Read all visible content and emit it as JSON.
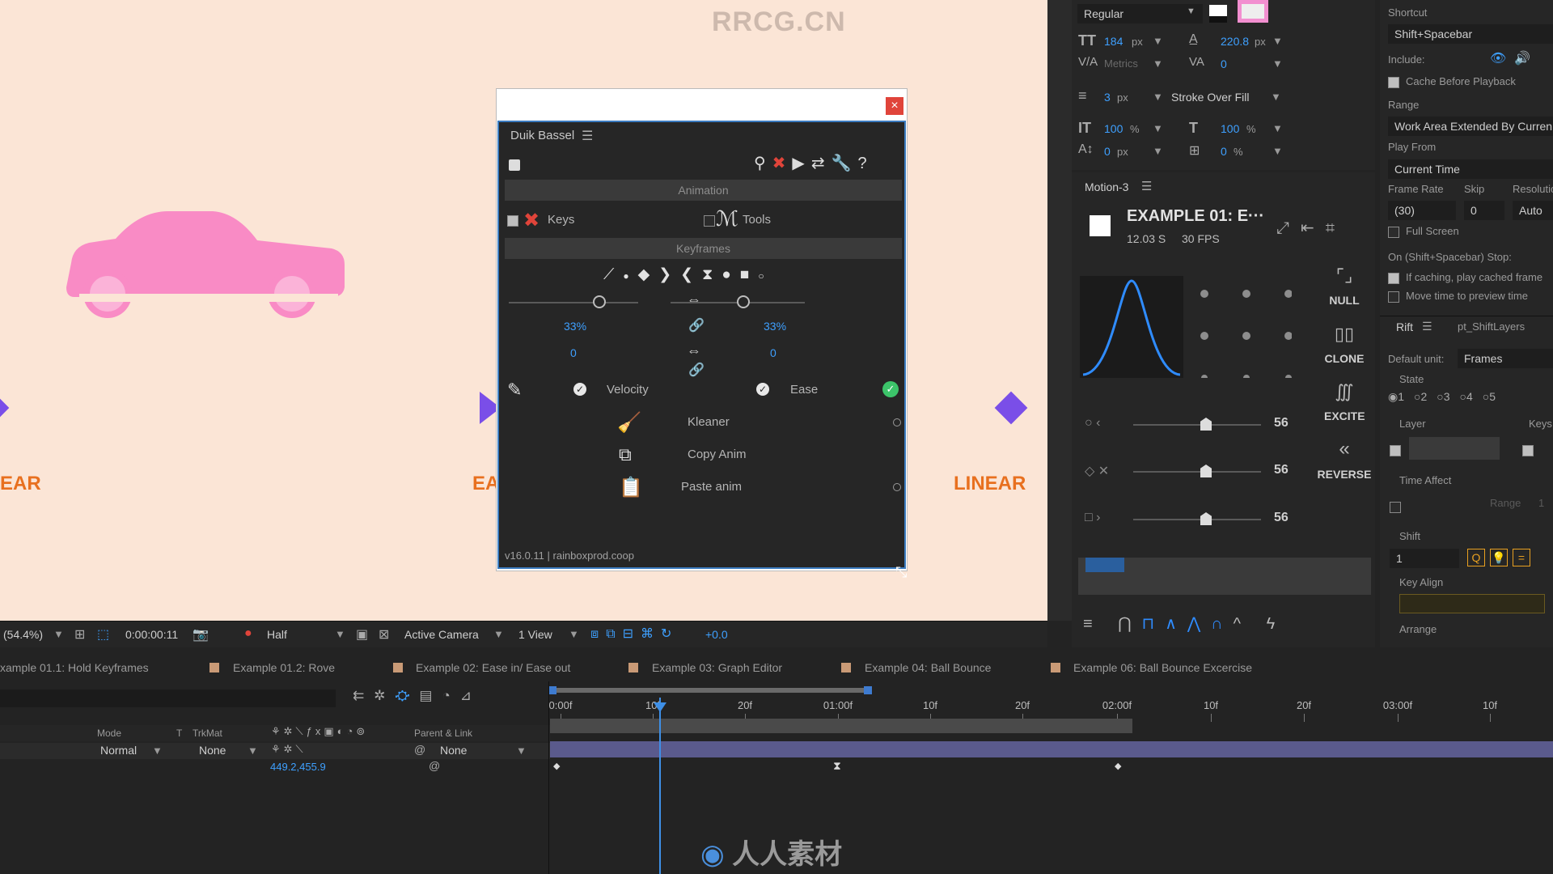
{
  "watermark": "RRCG.CN",
  "bottom_logo": "人人素材",
  "composition": {
    "label_left": "EAR",
    "label_mid": "EA",
    "label_right": "LINEAR",
    "car_color": "#f98bc5",
    "diamond_color": "#7a4ee8"
  },
  "duik": {
    "title": "Duik Bassel",
    "section_animation": "Animation",
    "keys_label": "Keys",
    "tools_label": "Tools",
    "section_keyframes": "Keyframes",
    "influence_left": "33%",
    "influence_right": "33%",
    "speed_left": "0",
    "speed_right": "0",
    "velocity_label": "Velocity",
    "ease_label": "Ease",
    "kleaner_label": "Kleaner",
    "copy_anim_label": "Copy Anim",
    "paste_anim_label": "Paste anim",
    "version": "v16.0.11 | rainboxprod.coop",
    "close_glyph": "×"
  },
  "character": {
    "font_style": "Regular",
    "font_size": "184",
    "font_size_unit": "px",
    "leading": "220.8",
    "leading_unit": "px",
    "kerning": "Metrics",
    "tracking": "0",
    "stroke_width": "3",
    "stroke_unit": "px",
    "stroke_mode": "Stroke Over Fill",
    "vscale": "100",
    "hscale": "100",
    "pct": "%",
    "baseline": "0",
    "baseline_unit": "px",
    "tsume": "0",
    "tsume_unit": "%"
  },
  "motion": {
    "title": "Motion-3",
    "comp_name": "EXAMPLE 01: E···",
    "duration": "12.03 S",
    "fps": "30 FPS",
    "null_label": "NULL",
    "clone_label": "CLONE",
    "excite_label": "EXCITE",
    "reverse_label": "REVERSE",
    "slider1": "56",
    "slider2": "56",
    "slider3": "56"
  },
  "preview": {
    "shortcut_label": "Shortcut",
    "shortcut_value": "Shift+Spacebar",
    "include_label": "Include:",
    "cache_label": "Cache Before Playback",
    "range_label": "Range",
    "range_value": "Work Area Extended By Curren",
    "play_from_label": "Play From",
    "play_from_value": "Current Time",
    "frame_rate_label": "Frame Rate",
    "skip_label": "Skip",
    "resolution_label": "Resolutio",
    "frame_rate_value": "(30)",
    "skip_value": "0",
    "resolution_value": "Auto",
    "full_screen": "Full Screen",
    "stop_label": "On (Shift+Spacebar) Stop:",
    "if_caching": "If caching, play cached frame",
    "move_time": "Move time to preview time",
    "rift_tab": "Rift",
    "shift_layers_tab": "pt_ShiftLayers",
    "default_unit_label": "Default unit:",
    "default_unit_value": "Frames",
    "state_label": "State",
    "states": [
      "1",
      "2",
      "3",
      "4",
      "5"
    ],
    "layer_label": "Layer",
    "keys_label": "Keys",
    "time_affect_label": "Time Affect",
    "range_field": "Range",
    "range_num": "1",
    "shift_label": "Shift",
    "shift_value": "1",
    "key_align_label": "Key Align",
    "arrange_label": "Arrange"
  },
  "viewer": {
    "zoom": "(54.4%)",
    "timecode": "0:00:00:11",
    "resolution": "Half",
    "camera": "Active Camera",
    "views": "1 View",
    "exposure": "+0.0"
  },
  "tabs": [
    "xample 01.1: Hold Keyframes",
    "Example 01.2: Rove",
    "Example 02: Ease in/ Ease out",
    "Example 03: Graph Editor",
    "Example 04: Ball Bounce",
    "Example 06: Ball Bounce Excercise"
  ],
  "timeline": {
    "col_mode": "Mode",
    "col_t": "T",
    "col_trkmat": "TrkMat",
    "col_parent": "Parent & Link",
    "mode_value": "Normal",
    "trkmat_value": "None",
    "parent_value": "None",
    "position_value": "449.2,455.9",
    "ruler": [
      "0:00f",
      "10f",
      "20f",
      "01:00f",
      "10f",
      "20f",
      "02:00f",
      "10f",
      "20f",
      "03:00f",
      "10f"
    ]
  }
}
